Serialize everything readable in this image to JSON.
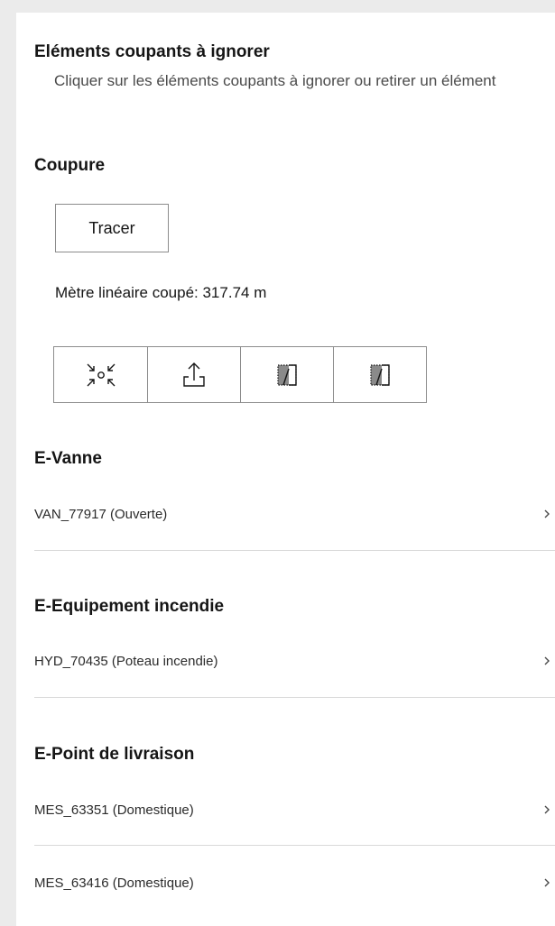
{
  "ignore_section": {
    "title": "Eléments coupants à ignorer",
    "description": "Cliquer sur les éléments coupants à ignorer ou retirer un élément"
  },
  "coupure": {
    "title": "Coupure",
    "trace_button": "Tracer",
    "meter_text": "Mètre linéaire coupé: 317.74 m",
    "tools": [
      {
        "icon": "collapse-icon"
      },
      {
        "icon": "export-icon"
      },
      {
        "icon": "select-polygon-icon"
      },
      {
        "icon": "select-polygon-icon"
      }
    ]
  },
  "groups": [
    {
      "title": "E-Vanne",
      "items": [
        {
          "label": "VAN_77917 (Ouverte)"
        }
      ]
    },
    {
      "title": "E-Equipement incendie",
      "items": [
        {
          "label": "HYD_70435 (Poteau incendie)"
        }
      ]
    },
    {
      "title": "E-Point de livraison",
      "items": [
        {
          "label": "MES_63351 (Domestique)"
        },
        {
          "label": "MES_63416 (Domestique)"
        }
      ]
    }
  ]
}
